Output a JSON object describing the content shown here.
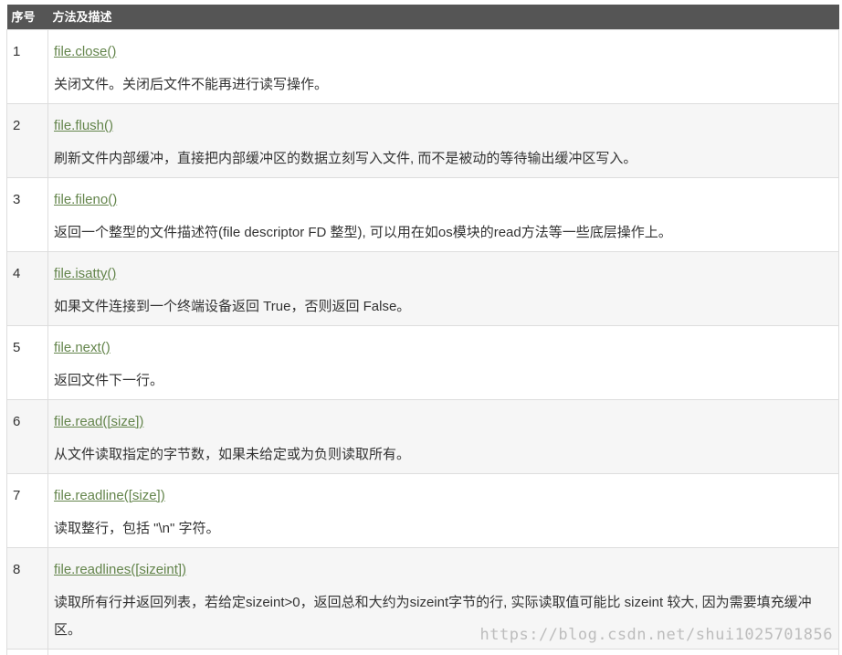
{
  "header": {
    "col_num": "序号",
    "col_desc": "方法及描述"
  },
  "rows": [
    {
      "num": "1",
      "method": "file.close()",
      "desc": "关闭文件。关闭后文件不能再进行读写操作。"
    },
    {
      "num": "2",
      "method": "file.flush()",
      "desc": "刷新文件内部缓冲，直接把内部缓冲区的数据立刻写入文件, 而不是被动的等待输出缓冲区写入。"
    },
    {
      "num": "3",
      "method": "file.fileno()",
      "desc": "返回一个整型的文件描述符(file descriptor FD 整型), 可以用在如os模块的read方法等一些底层操作上。"
    },
    {
      "num": "4",
      "method": "file.isatty()",
      "desc": "如果文件连接到一个终端设备返回 True，否则返回 False。"
    },
    {
      "num": "5",
      "method": "file.next()",
      "desc": "返回文件下一行。"
    },
    {
      "num": "6",
      "method": "file.read([size])",
      "desc": "从文件读取指定的字节数，如果未给定或为负则读取所有。"
    },
    {
      "num": "7",
      "method": "file.readline([size])",
      "desc": "读取整行，包括 \"\\n\" 字符。"
    },
    {
      "num": "8",
      "method": "file.readlines([sizeint])",
      "desc": "读取所有行并返回列表，若给定sizeint>0，返回总和大约为sizeint字节的行, 实际读取值可能比 sizeint 较大, 因为需要填充缓冲区。"
    }
  ],
  "watermark": "https://blog.csdn.net/shui1025701856",
  "colors": {
    "header_bg": "#555555",
    "link": "#64854c",
    "alt_row": "#f6f6f6",
    "border": "#dddddd"
  }
}
